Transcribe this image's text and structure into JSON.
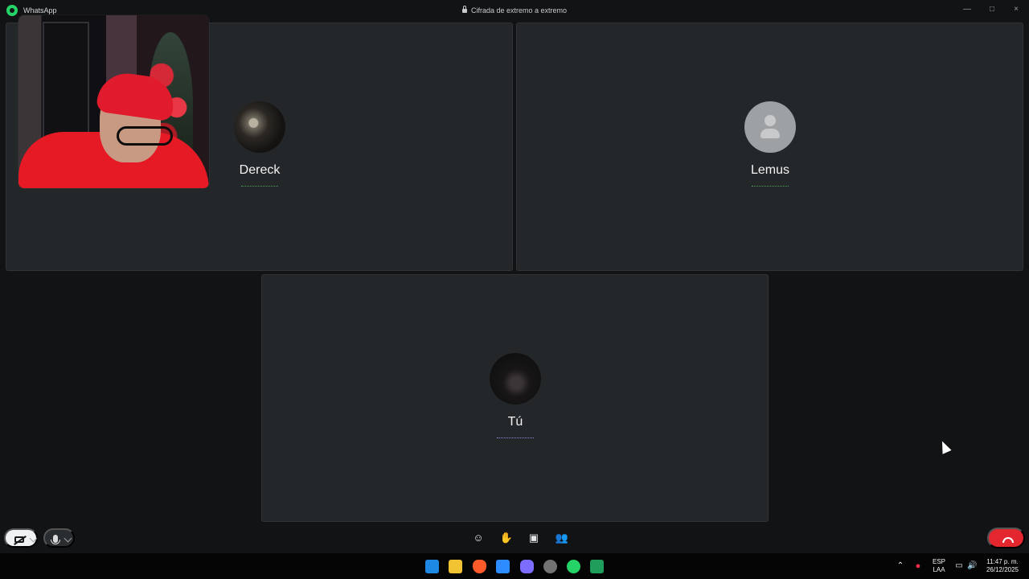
{
  "window": {
    "app_name": "WhatsApp",
    "encryption": "Cifrada de extremo a extremo",
    "controls": [
      "—",
      "□",
      "×"
    ]
  },
  "participants": [
    {
      "name": "Dereck",
      "avatar": "photo-avatar",
      "speaking_indicator": "green-dotted-line"
    },
    {
      "name": "Lemus",
      "avatar": "default-user-icon",
      "speaking_indicator": "green-dotted-line"
    },
    {
      "name": "Tú",
      "avatar": "dark-photo-avatar",
      "speaking_indicator": "purple-dotted-line"
    }
  ],
  "call_controls": {
    "camera": "camera-off-icon",
    "camera_menu": "chevron-down-icon",
    "microphone": "microphone-icon",
    "microphone_menu": "chevron-down-icon",
    "center": [
      "emoji-icon",
      "raise-hand-icon",
      "share-screen-icon",
      "participants-icon"
    ],
    "end_call": "hangup-icon"
  },
  "taskbar": {
    "icons": [
      "windows-icon",
      "files-icon",
      "brave-icon",
      "store-icon",
      "game-icon",
      "chrome-icon",
      "whatsapp-icon",
      "spreadsheet-icon"
    ],
    "language": "ESP",
    "region": "LAA",
    "time": "11:47 p. m.",
    "date": "26/12/2025"
  },
  "colors": {
    "window_bg": "#121314",
    "tile_bg": "#24272a",
    "speaking_green": "#4f9f57",
    "speaking_purple": "#8e88d6",
    "end_call_red": "#e4262f"
  }
}
